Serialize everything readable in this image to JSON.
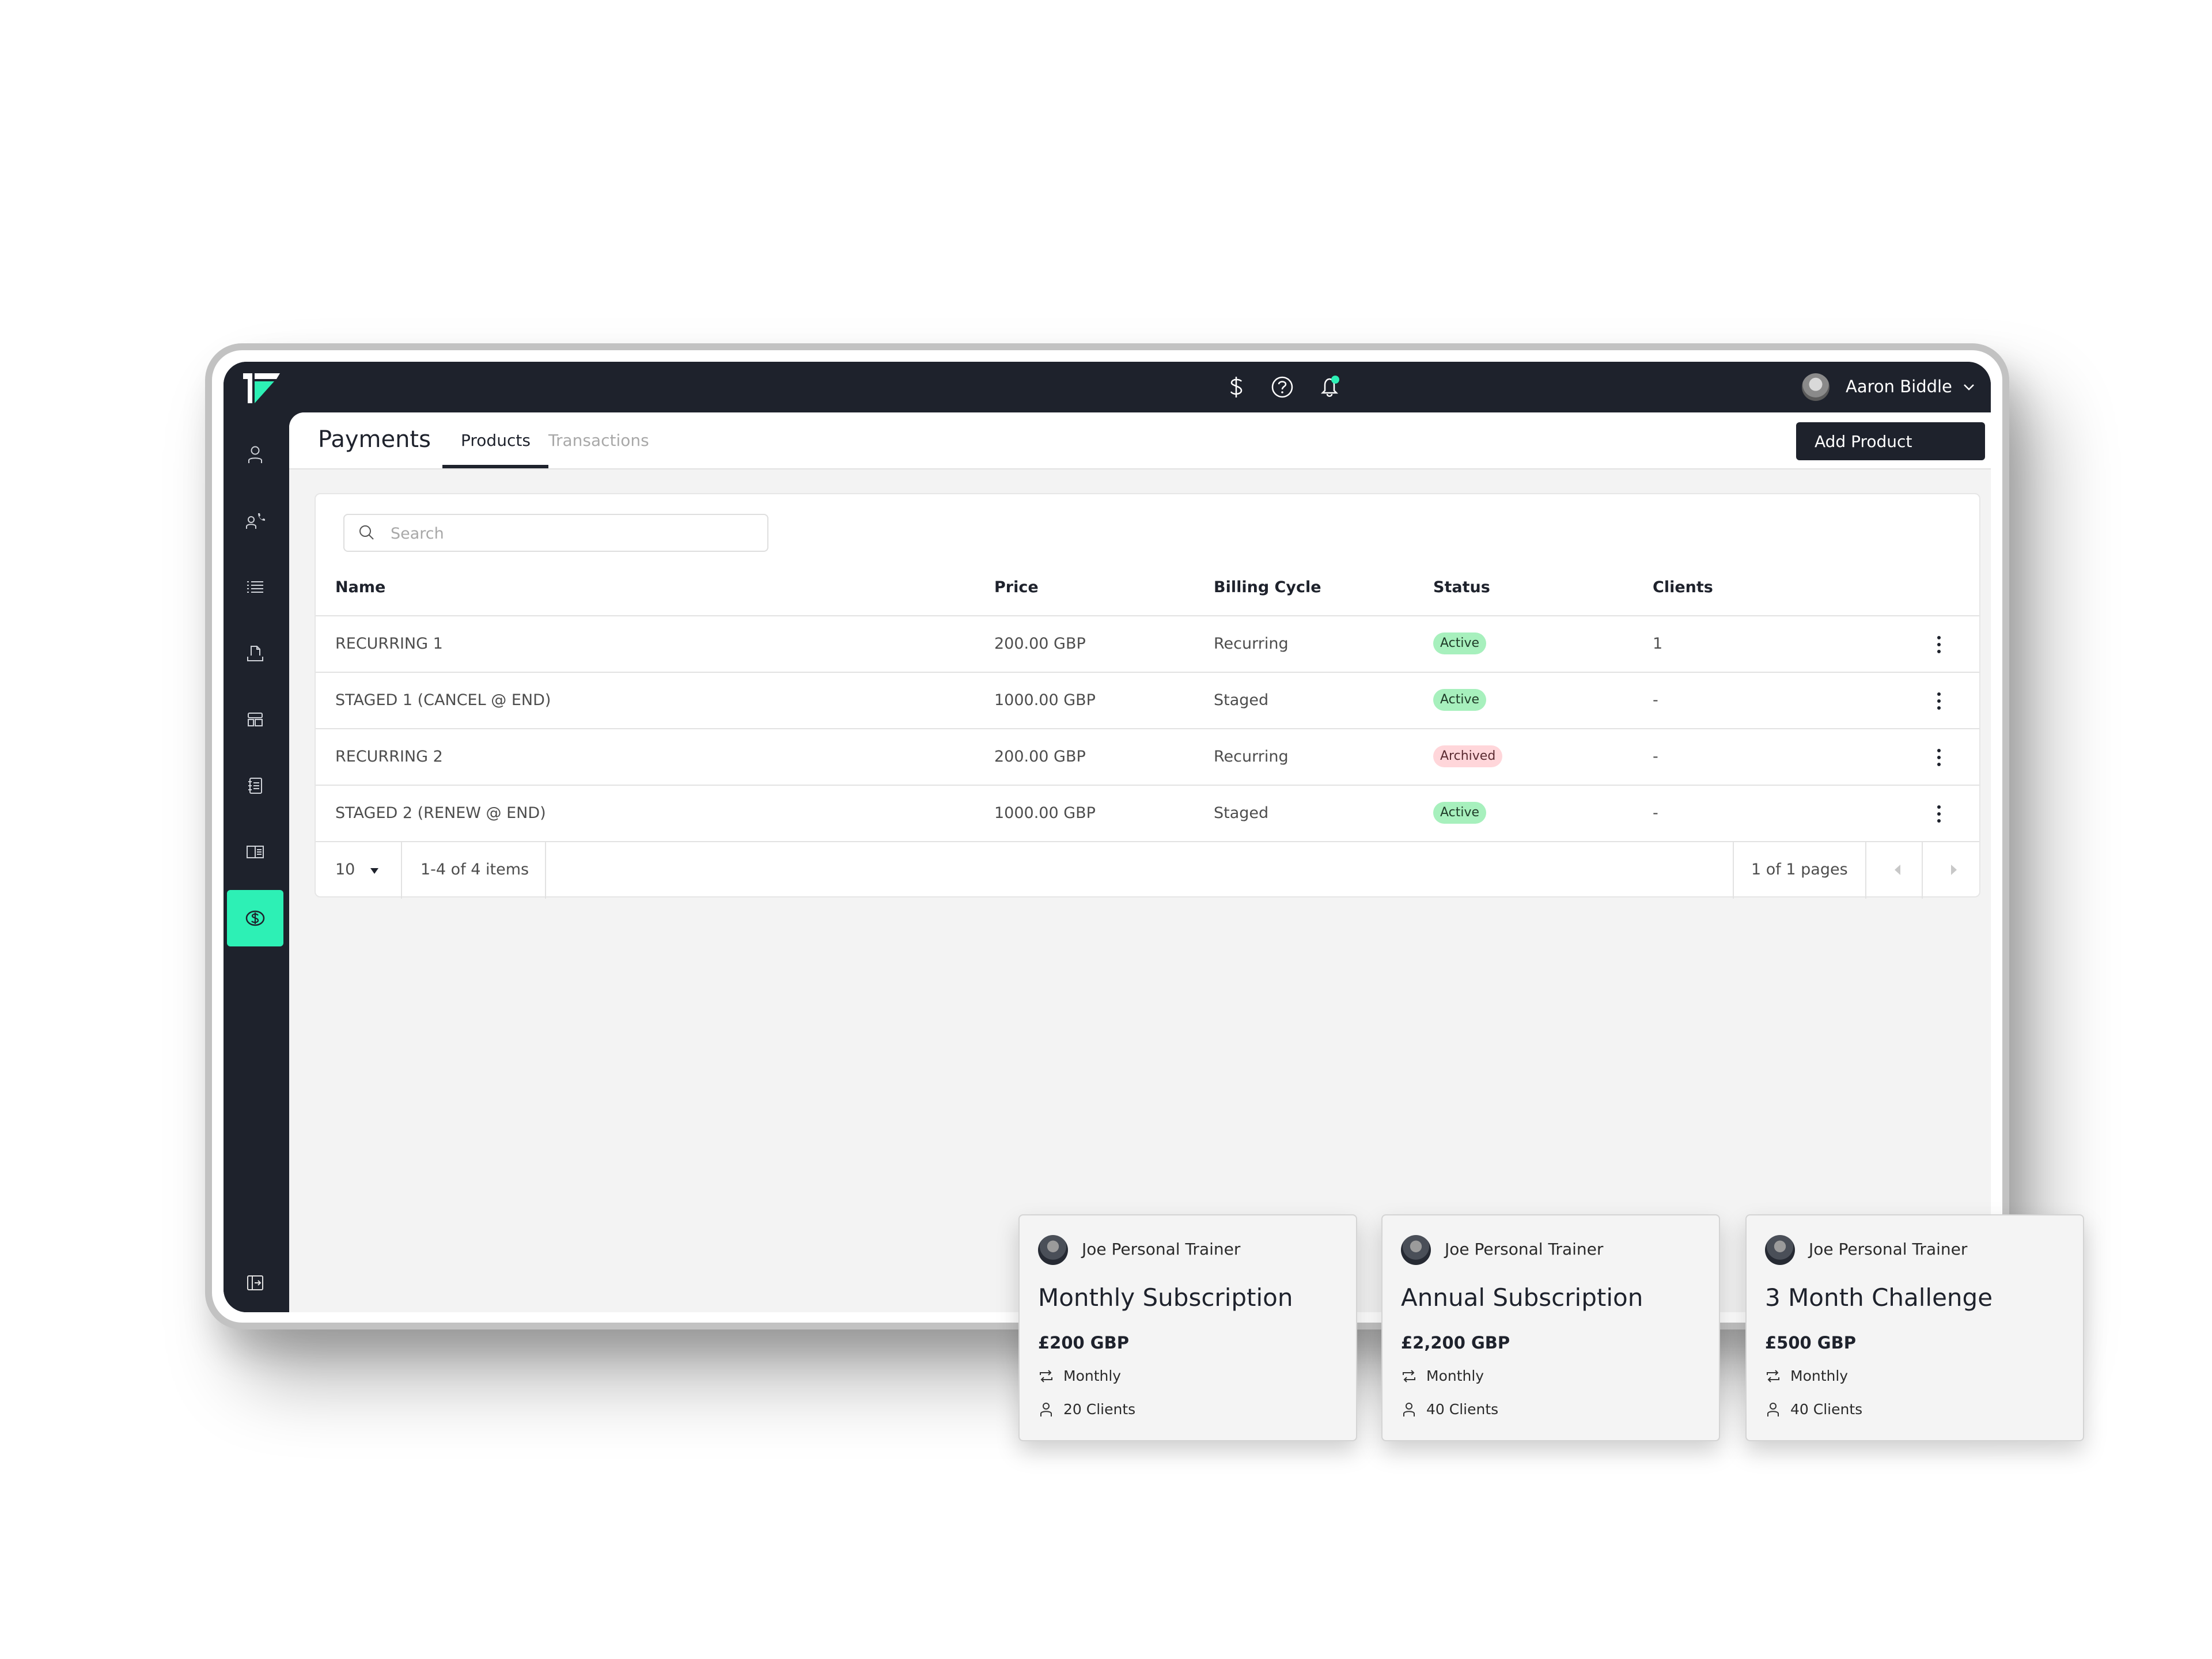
{
  "topbar": {
    "icons": [
      "dollar-icon",
      "help-icon",
      "bell-icon"
    ],
    "notification_dot_color": "#2df0b5",
    "user_name": "Aaron Biddle"
  },
  "sidebar": {
    "items": [
      {
        "icon": "user-icon",
        "active": false
      },
      {
        "icon": "user-call-icon",
        "active": false
      },
      {
        "icon": "list-icon",
        "active": false
      },
      {
        "icon": "document-tray-icon",
        "active": false
      },
      {
        "icon": "layout-icon",
        "active": false
      },
      {
        "icon": "notebook-icon",
        "active": false
      },
      {
        "icon": "book-open-icon",
        "active": false
      },
      {
        "icon": "currency-icon",
        "active": true
      }
    ],
    "bottom_icon": "collapse-expand-icon",
    "accent_color": "#2df0b5"
  },
  "header": {
    "title": "Payments",
    "tabs": [
      {
        "label": "Products",
        "active": true
      },
      {
        "label": "Transactions",
        "active": false
      }
    ],
    "add_button_label": "Add Product"
  },
  "search": {
    "placeholder": "Search",
    "value": ""
  },
  "table": {
    "columns": [
      "Name",
      "Price",
      "Billing Cycle",
      "Status",
      "Clients"
    ],
    "rows": [
      {
        "name": "RECURRING 1",
        "price": "200.00 GBP",
        "billing_cycle": "Recurring",
        "status": "Active",
        "clients": "1"
      },
      {
        "name": "STAGED 1 (CANCEL @ END)",
        "price": "1000.00 GBP",
        "billing_cycle": "Staged",
        "status": "Active",
        "clients": "-"
      },
      {
        "name": "RECURRING 2",
        "price": "200.00 GBP",
        "billing_cycle": "Recurring",
        "status": "Archived",
        "clients": "-"
      },
      {
        "name": "STAGED 2 (RENEW @ END)",
        "price": "1000.00 GBP",
        "billing_cycle": "Staged",
        "status": "Active",
        "clients": "-"
      }
    ],
    "status_colors": {
      "Active": "#a7f0bd",
      "Archived": "#ffd6da"
    }
  },
  "pagination": {
    "page_size": "10",
    "items_text": "1-4 of 4 items",
    "pages_text": "1 of 1 pages"
  },
  "product_cards": [
    {
      "trainer": "Joe Personal Trainer",
      "title": "Monthly Subscription",
      "price": "£200 GBP",
      "cycle": "Monthly",
      "clients": "20 Clients"
    },
    {
      "trainer": "Joe Personal Trainer",
      "title": "Annual Subscription",
      "price": "£2,200 GBP",
      "cycle": "Monthly",
      "clients": "40 Clients"
    },
    {
      "trainer": "Joe Personal Trainer",
      "title": "3 Month Challenge",
      "price": "£500 GBP",
      "cycle": "Monthly",
      "clients": "40 Clients"
    }
  ]
}
